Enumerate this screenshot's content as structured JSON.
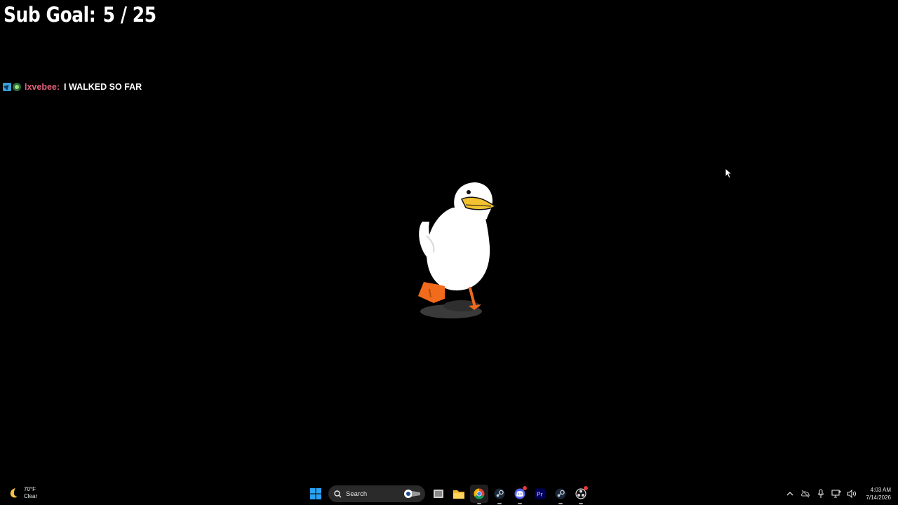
{
  "overlay": {
    "sub_goal_label": "Sub Goal:",
    "sub_goal_value": "5 / 25"
  },
  "chat": {
    "username": "lxvebee:",
    "message": "I WALKED SO FAR"
  },
  "taskbar": {
    "weather": {
      "temp": "70°F",
      "condition": "Clear",
      "icon": "moon-icon"
    },
    "search": {
      "placeholder": "Search"
    },
    "apps": [
      "start-icon",
      "search-icon",
      "task-view-icon",
      "file-explorer-icon",
      "chrome-icon",
      "steam-icon",
      "discord-icon",
      "premiere-pro-icon",
      "steam-icon",
      "obs-icon"
    ],
    "clock": {
      "time": "4:03 AM",
      "date": "7/14/2026"
    }
  },
  "colors": {
    "background": "#000000",
    "chat_username": "#e0607a",
    "goose_beak": "#f2c230",
    "goose_feet": "#f26a1b"
  }
}
